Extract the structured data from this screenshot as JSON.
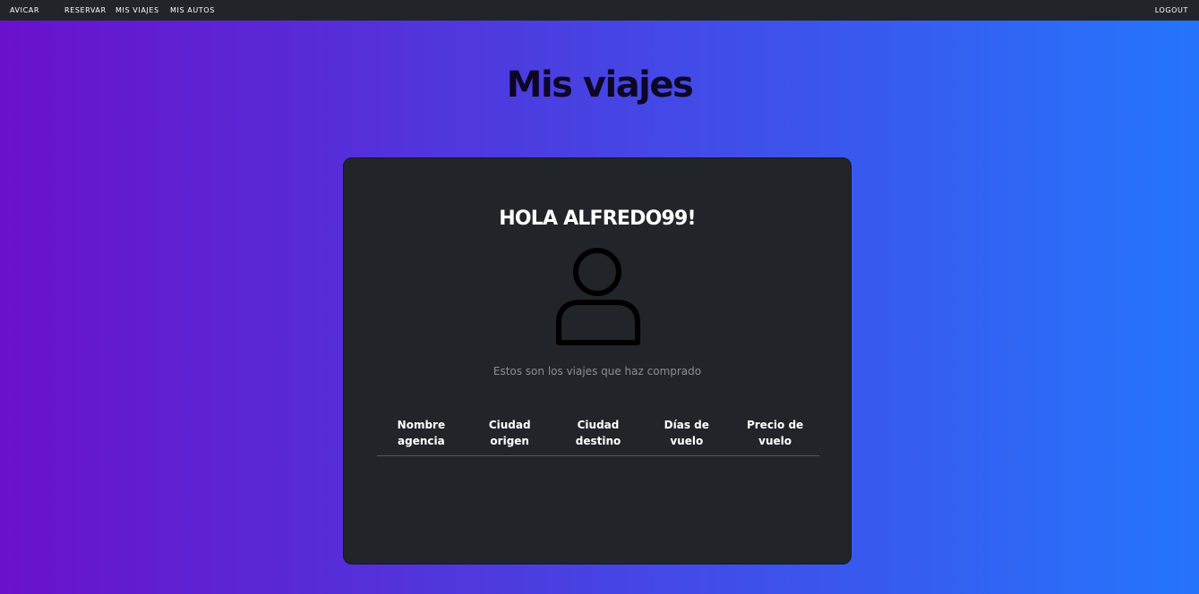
{
  "navbar": {
    "brand": "AVICAR",
    "links": [
      "RESERVAR",
      "MIS VIAJES",
      "MIS AUTOS"
    ],
    "logout": "LOGOUT"
  },
  "page": {
    "title": "Mis viajes"
  },
  "card": {
    "greeting": "HOLA ALFREDO99!",
    "avatar_icon": "user-icon",
    "subtitle": "Estos son los viajes que haz comprado",
    "table": {
      "headers": [
        [
          "Nombre",
          "agencia"
        ],
        [
          "Ciudad",
          "origen"
        ],
        [
          "Ciudad",
          "destino"
        ],
        [
          "Días de",
          "vuelo"
        ],
        [
          "Precio de",
          "vuelo"
        ]
      ],
      "rows": []
    }
  },
  "colors": {
    "gradient_start": "#6a11cb",
    "gradient_end": "#2575fc",
    "navbar_bg": "#212529",
    "card_bg": "#212529"
  }
}
